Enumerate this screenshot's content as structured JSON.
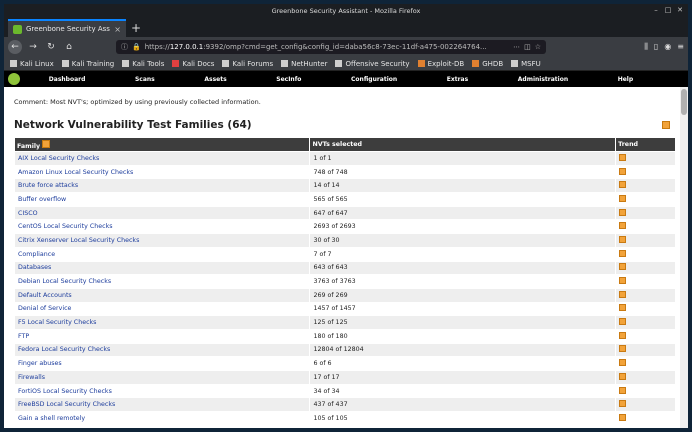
{
  "window_title": "Greenbone Security Assistant - Mozilla Firefox",
  "tab": {
    "title": "Greenbone Security Assis",
    "close": "×"
  },
  "new_tab": "+",
  "url": {
    "prefix": "https://",
    "host": "127.0.0.1",
    "rest": ":9392/omp?cmd=get_config&config_id=daba56c8-73ec-11df-a475-002264764..."
  },
  "bookmarks": [
    {
      "label": "Kali Linux",
      "color": "#cfcfcf"
    },
    {
      "label": "Kali Training",
      "color": "#cfcfcf"
    },
    {
      "label": "Kali Tools",
      "color": "#cfcfcf"
    },
    {
      "label": "Kali Docs",
      "color": "#e04040"
    },
    {
      "label": "Kali Forums",
      "color": "#cfcfcf"
    },
    {
      "label": "NetHunter",
      "color": "#cfcfcf"
    },
    {
      "label": "Offensive Security",
      "color": "#cfcfcf"
    },
    {
      "label": "Exploit-DB",
      "color": "#e08030"
    },
    {
      "label": "GHDB",
      "color": "#e08030"
    },
    {
      "label": "MSFU",
      "color": "#cfcfcf"
    }
  ],
  "menu": [
    "Dashboard",
    "Scans",
    "Assets",
    "SecInfo",
    "Configuration",
    "Extras",
    "Administration",
    "Help"
  ],
  "comment": "Comment: Most NVT's; optimized by using previously collected information.",
  "section_title": "Network Vulnerability Test Families (64)",
  "table": {
    "headers": {
      "family": "Family",
      "nvts": "NVTs selected",
      "trend": "Trend"
    },
    "rows": [
      {
        "family": "AIX Local Security Checks",
        "nvts": "1 of 1"
      },
      {
        "family": "Amazon Linux Local Security Checks",
        "nvts": "748 of 748"
      },
      {
        "family": "Brute force attacks",
        "nvts": "14 of 14"
      },
      {
        "family": "Buffer overflow",
        "nvts": "565 of 565"
      },
      {
        "family": "CISCO",
        "nvts": "647 of 647"
      },
      {
        "family": "CentOS Local Security Checks",
        "nvts": "2693 of 2693"
      },
      {
        "family": "Citrix Xenserver Local Security Checks",
        "nvts": "30 of 30"
      },
      {
        "family": "Compliance",
        "nvts": "7 of 7"
      },
      {
        "family": "Databases",
        "nvts": "643 of 643"
      },
      {
        "family": "Debian Local Security Checks",
        "nvts": "3763 of 3763"
      },
      {
        "family": "Default Accounts",
        "nvts": "269 of 269"
      },
      {
        "family": "Denial of Service",
        "nvts": "1457 of 1457"
      },
      {
        "family": "F5 Local Security Checks",
        "nvts": "125 of 125"
      },
      {
        "family": "FTP",
        "nvts": "180 of 180"
      },
      {
        "family": "Fedora Local Security Checks",
        "nvts": "12804 of 12804"
      },
      {
        "family": "Finger abuses",
        "nvts": "6 of 6"
      },
      {
        "family": "Firewalls",
        "nvts": "17 of 17"
      },
      {
        "family": "FortiOS Local Security Checks",
        "nvts": "34 of 34"
      },
      {
        "family": "FreeBSD Local Security Checks",
        "nvts": "437 of 437"
      },
      {
        "family": "Gain a shell remotely",
        "nvts": "105 of 105"
      }
    ]
  }
}
